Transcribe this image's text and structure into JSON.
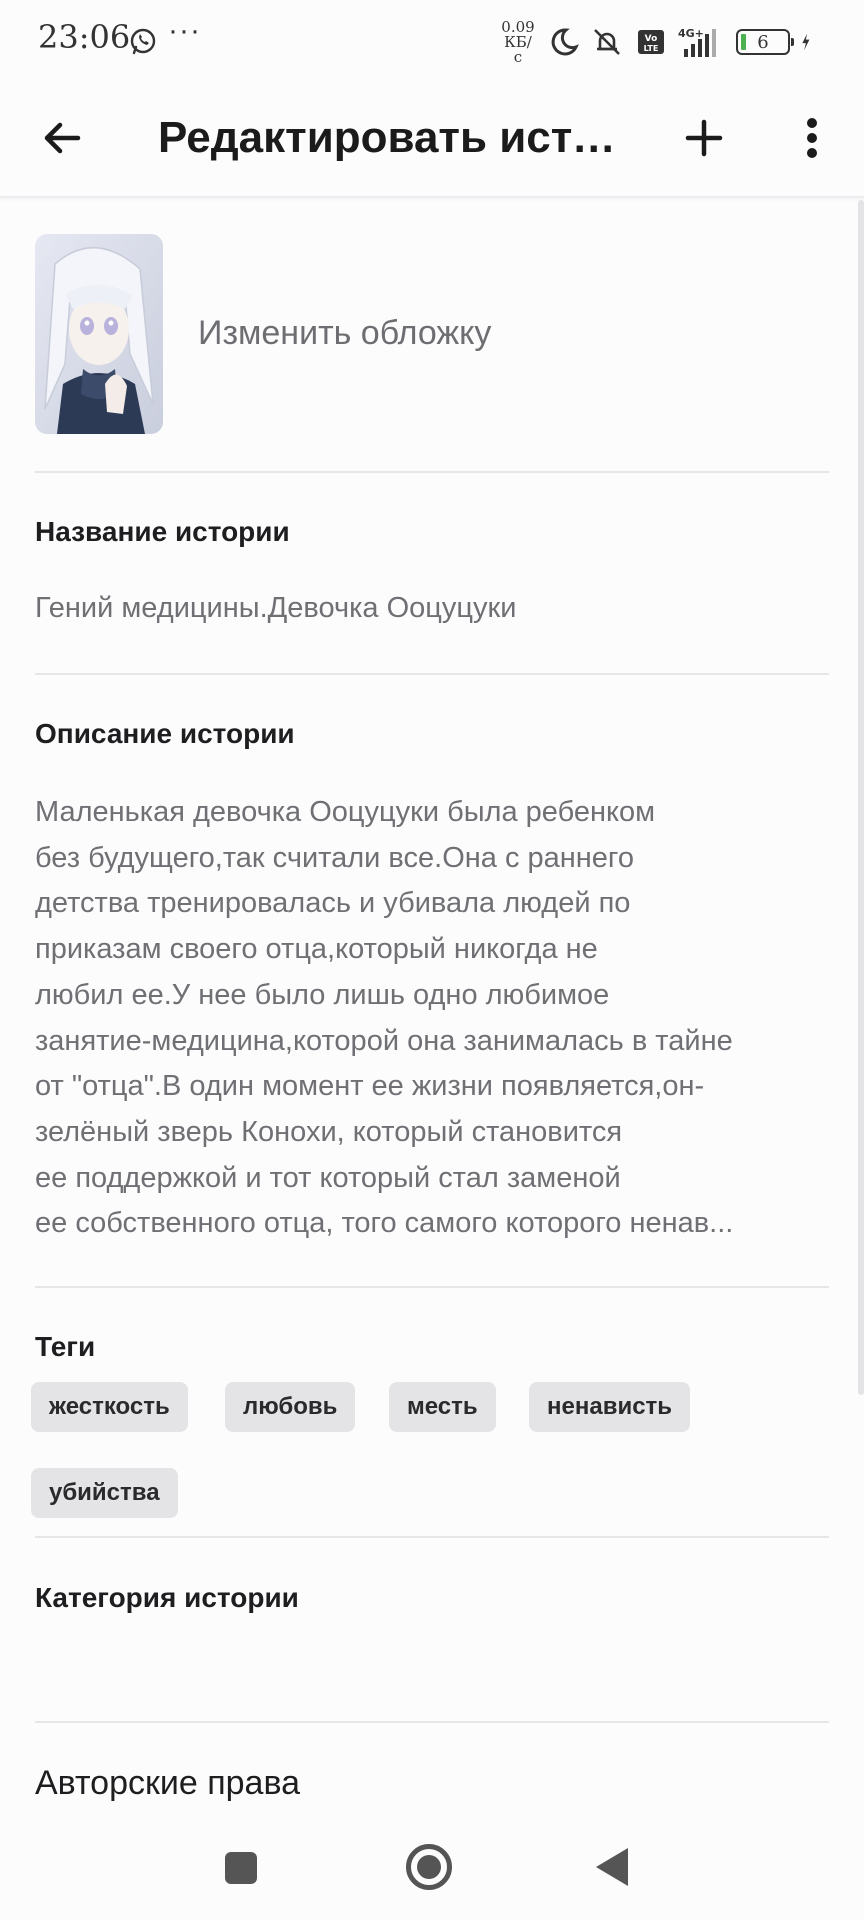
{
  "status_bar": {
    "time": "23:06",
    "dots": "···",
    "net_speed_value": "0.09",
    "net_speed_unit": "КБ/с",
    "battery": "6",
    "icons": [
      "whatsapp-icon",
      "moon-icon",
      "mute-icon",
      "volte-icon",
      "signal-4g-icon",
      "battery-icon",
      "charging-icon"
    ]
  },
  "app_bar": {
    "title": "Редактировать исто..."
  },
  "cover": {
    "change_label": "Изменить обложку"
  },
  "story_title": {
    "label": "Название истории",
    "value": "Гений медицины.Девочка Ооцуцуки"
  },
  "description": {
    "label": "Описание истории",
    "lines": [
      "Маленькая девочка Ооцуцуки была ребенком",
      "без будущего,так считали все.Она с раннего",
      "детства тренировалась и убивала людей по",
      "приказам своего отца,который никогда не",
      "любил ее.У нее было лишь одно любимое",
      "занятие-медицина,которой она занималась в тайне",
      "от \"отца\".В один момент ее жизни появляется,он-",
      "зелёный зверь Конохи, который становится",
      "ее поддержкой и тот который стал заменой",
      "ее собственного отца, того самого которого ненав..."
    ]
  },
  "tags": {
    "label": "Теги",
    "items": [
      "жесткость",
      "любовь",
      "месть",
      "ненависть",
      "убийства"
    ]
  },
  "category": {
    "label": "Категория истории",
    "value": ""
  },
  "copyright": {
    "label": "Авторские права"
  },
  "colors": {
    "background": "#fdfcfd",
    "text_primary": "#1e1e20",
    "text_secondary": "#6f6f74",
    "tag_background": "#e4e4e6",
    "divider": "#e6e6e8"
  }
}
